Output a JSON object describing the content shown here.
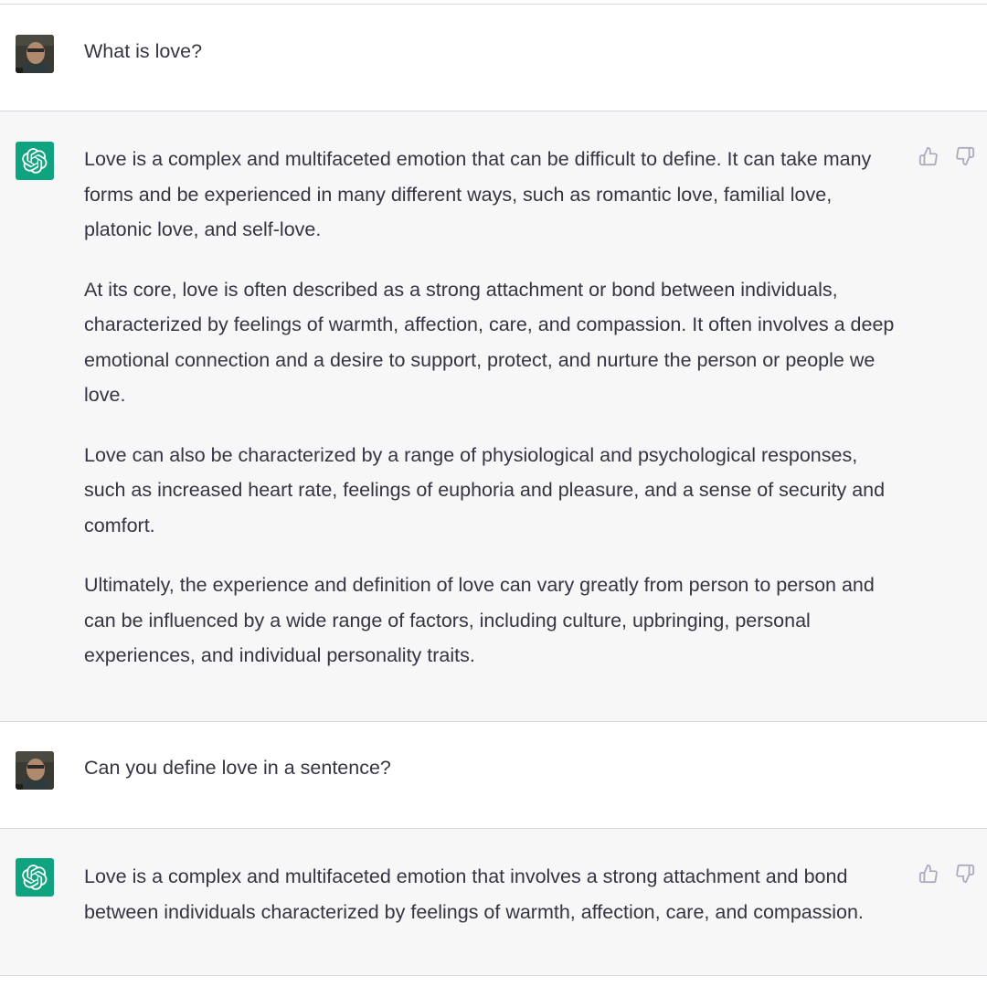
{
  "conversation": [
    {
      "role": "user",
      "text": "What is love?"
    },
    {
      "role": "assistant",
      "paragraphs": [
        "Love is a complex and multifaceted emotion that can be difficult to define. It can take many forms and be experienced in many different ways, such as romantic love, familial love, platonic love, and self-love.",
        "At its core, love is often described as a strong attachment or bond between individuals, characterized by feelings of warmth, affection, care, and compassion. It often involves a deep emotional connection and a desire to support, protect, and nurture the person or people we love.",
        "Love can also be characterized by a range of physiological and psychological responses, such as increased heart rate, feelings of euphoria and pleasure, and a sense of security and comfort.",
        "Ultimately, the experience and definition of love can vary greatly from person to person and can be influenced by a wide range of factors, including culture, upbringing, personal experiences, and individual personality traits."
      ]
    },
    {
      "role": "user",
      "text": "Can you define love in a sentence?"
    },
    {
      "role": "assistant",
      "paragraphs": [
        "Love is a complex and multifaceted emotion that involves a strong attachment and bond between individuals characterized by feelings of warmth, affection, care, and compassion."
      ]
    }
  ],
  "icons": {
    "user_avatar": "user-photo-avatar",
    "assistant_avatar": "openai-logo-icon",
    "like": "thumbs-up-icon",
    "dislike": "thumbs-down-icon"
  },
  "colors": {
    "assistant_bg": "#f7f7f8",
    "user_bg": "#ffffff",
    "brand_green": "#10a37f",
    "text": "#343541",
    "divider": "#d9d9e3",
    "icon_gray": "#acacbe"
  }
}
